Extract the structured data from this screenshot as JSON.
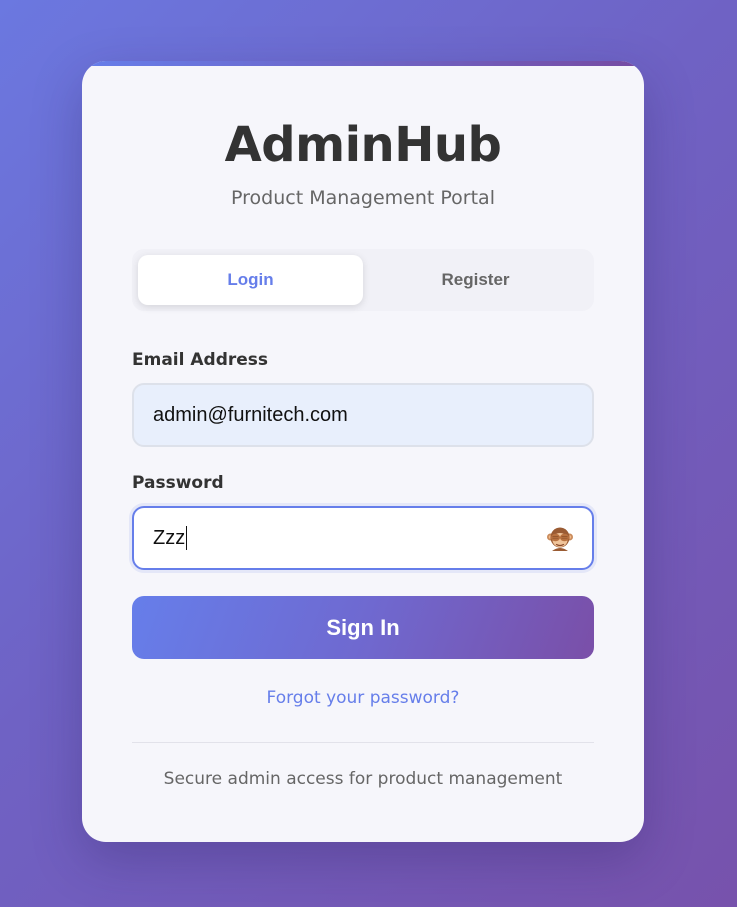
{
  "app": {
    "title": "AdminHub",
    "subtitle": "Product Management Portal"
  },
  "tabs": [
    {
      "label": "Login",
      "active": true
    },
    {
      "label": "Register",
      "active": false
    }
  ],
  "form": {
    "email": {
      "label": "Email Address",
      "value": "admin@furnitech.com"
    },
    "password": {
      "label": "Password",
      "value": "Zzz",
      "toggle_icon": "see-no-evil-monkey-icon"
    },
    "submit_label": "Sign In",
    "forgot_label": "Forgot your password?"
  },
  "footer": {
    "text": "Secure admin access for product management"
  },
  "colors": {
    "accent": "#667eea",
    "accent_end": "#764ba2",
    "card_background": "#f6f6fb"
  }
}
